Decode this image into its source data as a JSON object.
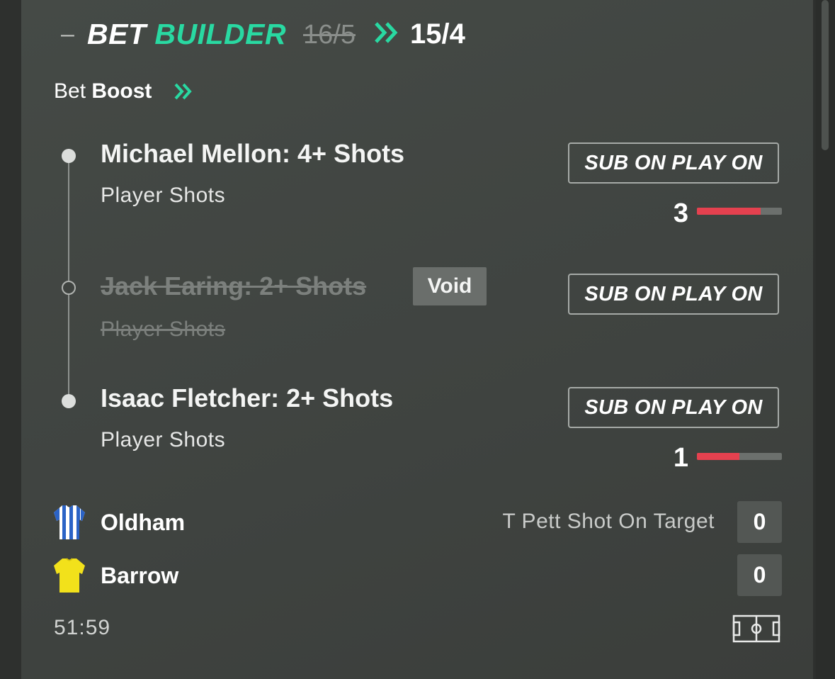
{
  "header": {
    "collapse_symbol": "–",
    "title_part1": "BET",
    "title_part2": "BUILDER",
    "old_odds": "16/5",
    "new_odds": "15/4",
    "accent_color": "#29d9a2"
  },
  "boost": {
    "prefix": "Bet",
    "label": "Boost"
  },
  "selections": [
    {
      "title": "Michael Mellon: 4+ Shots",
      "market": "Player Shots",
      "button": "SUB ON PLAY ON",
      "progress_value": "3",
      "progress_fraction": 0.75,
      "status": "active"
    },
    {
      "title": "Jack Earing: 2+ Shots",
      "market": "Player Shots",
      "button": "SUB ON PLAY ON",
      "badge": "Void",
      "status": "void"
    },
    {
      "title": "Isaac Fletcher: 2+ Shots",
      "market": "Player Shots",
      "button": "SUB ON PLAY ON",
      "progress_value": "1",
      "progress_fraction": 0.5,
      "status": "active"
    }
  ],
  "match": {
    "home_team": "Oldham",
    "away_team": "Barrow",
    "stat_label": "T Pett Shot On Target",
    "home_score": "0",
    "away_score": "0",
    "clock": "51:59",
    "icons": {
      "home_kit": "striped-shirt-icon",
      "away_kit": "yellow-shirt-icon",
      "pitch": "pitch-icon"
    }
  }
}
